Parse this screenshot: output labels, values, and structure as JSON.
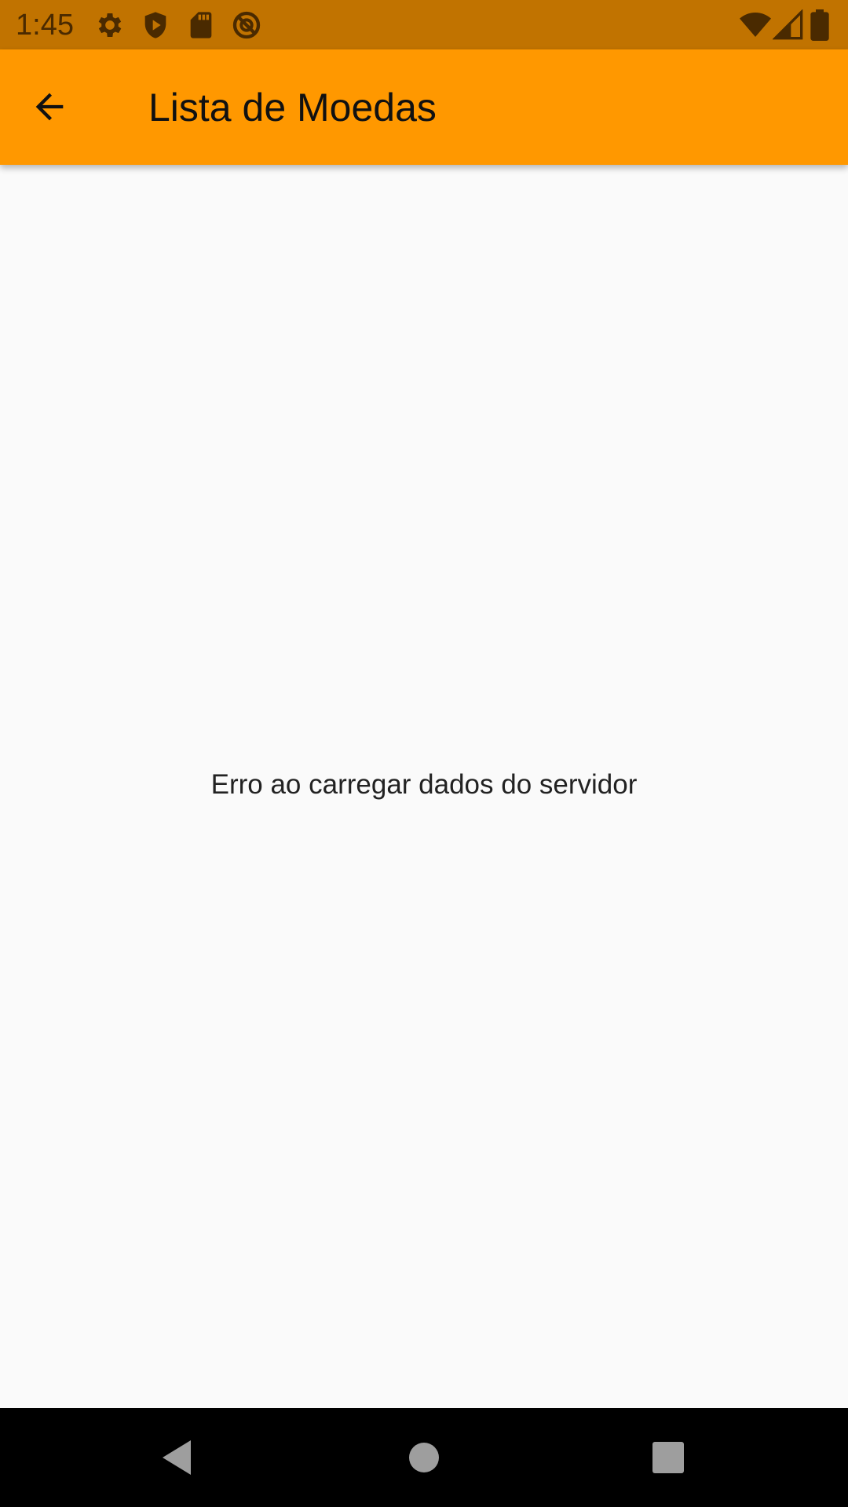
{
  "status_bar": {
    "time": "1:45",
    "icons_left": [
      "gear-icon",
      "shield-play-icon",
      "sd-card-icon",
      "no-disturb-icon"
    ],
    "icons_right": [
      "wifi-icon",
      "cell-signal-icon",
      "battery-icon"
    ],
    "background": "#c17300"
  },
  "app_bar": {
    "title": "Lista de Moedas",
    "back_icon": "arrow-back-icon",
    "background": "#ff9800"
  },
  "main": {
    "error_message": "Erro ao carregar dados do servidor"
  },
  "nav_bar": {
    "buttons": [
      "back-triangle-icon",
      "home-circle-icon",
      "recents-square-icon"
    ]
  }
}
